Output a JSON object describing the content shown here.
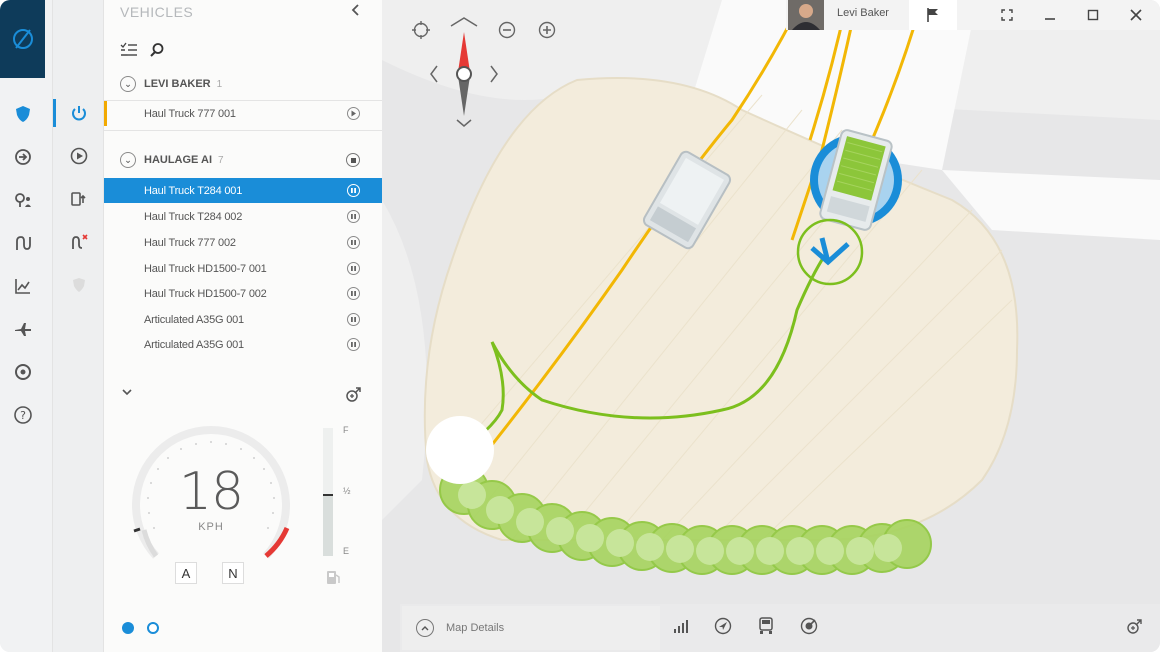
{
  "panel": {
    "title": "VEHICLES",
    "groups": [
      {
        "name": "LEVI BAKER",
        "count": "1"
      },
      {
        "name": "HAULAGE AI",
        "count": "7"
      }
    ],
    "items": [
      {
        "label": "Haul Truck 777 001"
      },
      {
        "label": "Haul Truck T284 001"
      },
      {
        "label": "Haul Truck T284 002"
      },
      {
        "label": "Haul Truck 777 002"
      },
      {
        "label": "Haul Truck HD1500-7 001"
      },
      {
        "label": "Haul Truck HD1500-7 002"
      },
      {
        "label": "Articulated A35G 001"
      },
      {
        "label": "Articulated A35G 001"
      }
    ],
    "selected_index": 1
  },
  "dashboard": {
    "speed": "18",
    "unit": "KPH",
    "gears": [
      "A",
      "N"
    ],
    "fuel_labels": {
      "full": "F",
      "half": "½",
      "empty": "E"
    },
    "fuel_level": 0.48
  },
  "header": {
    "user_name": "Levi Baker"
  },
  "bottom": {
    "map_details_label": "Map Details"
  },
  "colors": {
    "accent": "#1a8dd8",
    "brand": "#0e3b5a",
    "route_yellow": "#f2b705",
    "route_green": "#7cbf1e",
    "zone_fill": "#f3ecdc",
    "alert_red": "#e53935"
  },
  "icons": {
    "rail": [
      "shield-icon",
      "arrow-circle-icon",
      "location-person-icon",
      "route-icon",
      "chart-icon",
      "aircraft-icon",
      "settings-icon",
      "help-icon"
    ],
    "rail2": [
      "power-icon",
      "play-icon",
      "truck-upload-icon",
      "route-alert-icon",
      "shield-disabled-icon"
    ],
    "bottom": [
      "signal-icon",
      "navigate-icon",
      "vehicle-icon",
      "gps-icon",
      "male-add-icon"
    ]
  }
}
